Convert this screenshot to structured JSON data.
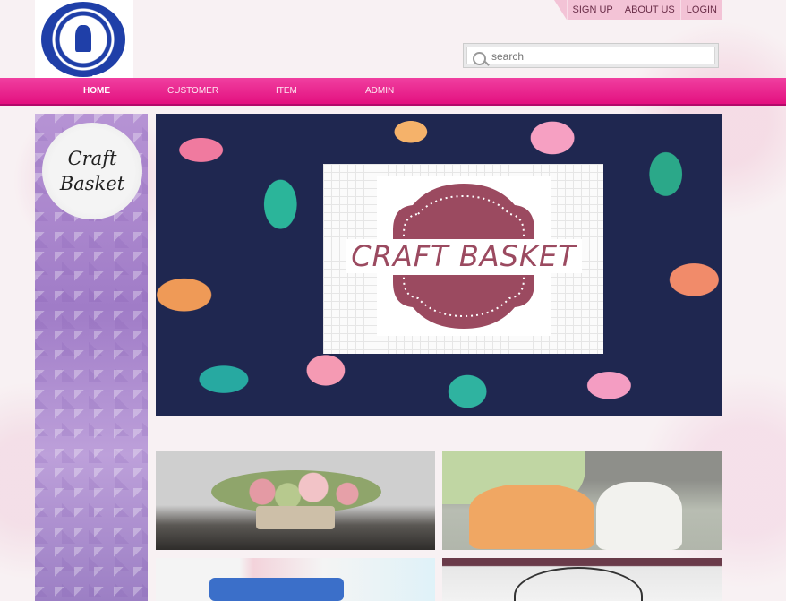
{
  "header": {
    "top_links": [
      "SIGN UP",
      "ABOUT US",
      "LOGIN"
    ],
    "search": {
      "placeholder": "search"
    }
  },
  "nav": {
    "items": [
      "HOME",
      "CUSTOMER",
      "ITEM",
      "ADMIN"
    ],
    "active": "HOME"
  },
  "sidebar": {
    "badge_text_1": "Craft",
    "badge_text_2": "Basket"
  },
  "banner": {
    "title": "CRAFT BASKET"
  },
  "colors": {
    "nav_pink": "#e3107f",
    "top_link_bg": "#f3c3d6",
    "banner_title": "#9b4a60",
    "sidebar_purple": "#a07cc7"
  },
  "icons": [
    "college-logo",
    "search-icon"
  ]
}
